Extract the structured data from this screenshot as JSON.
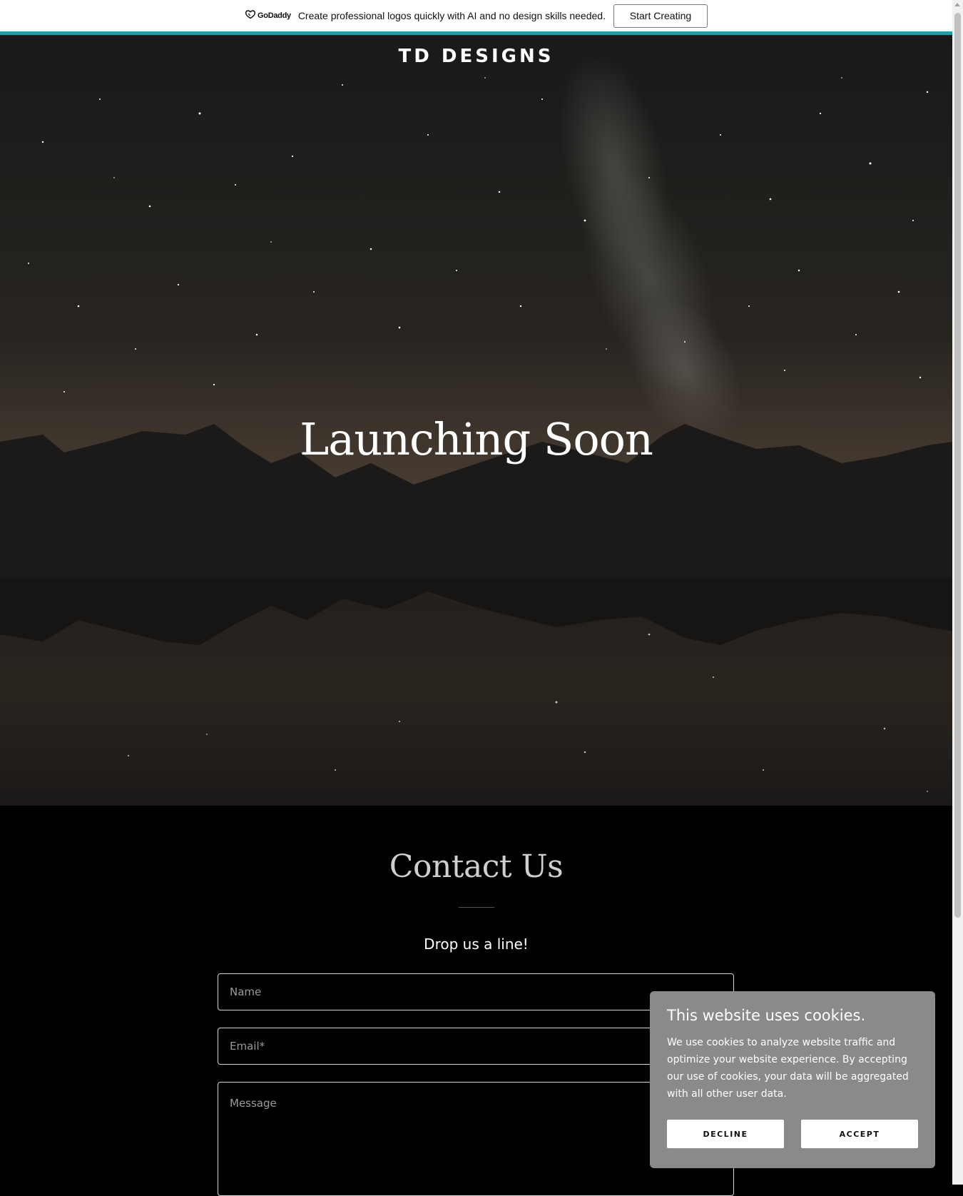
{
  "promo": {
    "logo_text": "GoDaddy",
    "message": "Create professional logos quickly with AI and no design skills needed.",
    "cta_label": "Start Creating",
    "accent_color": "#1aa0a8"
  },
  "hero": {
    "brand": "TD DESIGNS",
    "title": "Launching Soon"
  },
  "contact": {
    "title": "Contact Us",
    "subtitle": "Drop us a line!",
    "fields": {
      "name_placeholder": "Name",
      "email_placeholder": "Email*",
      "message_placeholder": "Message"
    }
  },
  "cookie": {
    "title": "This website uses cookies.",
    "body": "We use cookies to analyze website traffic and optimize your website experience. By accepting our use of cookies, your data will be aggregated with all other user data.",
    "decline_label": "DECLINE",
    "accept_label": "ACCEPT"
  }
}
